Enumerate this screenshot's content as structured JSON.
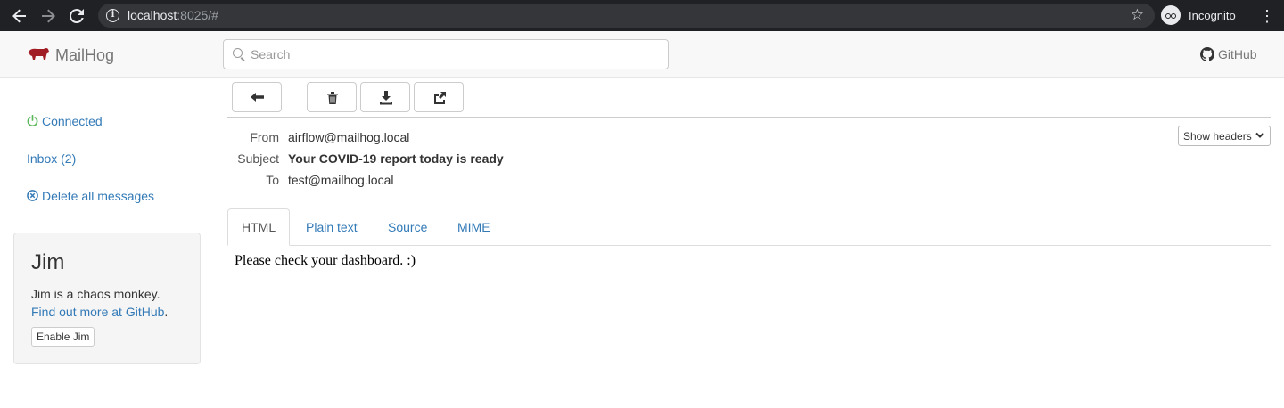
{
  "browser": {
    "url_host": "localhost",
    "url_rest": ":8025/#",
    "profile_label": "Incognito",
    "icons": [
      "back-arrow-icon",
      "forward-arrow-icon",
      "reload-icon",
      "info-icon",
      "star-icon",
      "incognito-icon",
      "kebab-menu-icon"
    ]
  },
  "app": {
    "brand": "MailHog",
    "brand_color": "#a01d26",
    "search_placeholder": "Search",
    "github_label": "GitHub"
  },
  "sidebar": {
    "connected_label": "Connected",
    "connected_color": "#5cb85c",
    "inbox_label": "Inbox (2)",
    "delete_all_label": "Delete all messages",
    "jim": {
      "title": "Jim",
      "description": "Jim is a chaos monkey.",
      "link_text": "Find out more at GitHub",
      "link_suffix": ".",
      "button_label": "Enable Jim"
    }
  },
  "toolbar": {
    "buttons": [
      "back-icon",
      "trash-icon",
      "download-icon",
      "release-icon"
    ]
  },
  "message": {
    "headers": [
      {
        "label": "From",
        "value": "airflow@mailhog.local"
      },
      {
        "label": "Subject",
        "value": "Your COVID-19 report today is ready"
      },
      {
        "label": "To",
        "value": "test@mailhog.local"
      }
    ],
    "show_headers_label": "Show headers",
    "tabs": [
      "HTML",
      "Plain text",
      "Source",
      "MIME"
    ],
    "active_tab": "HTML",
    "body": "Please check your dashboard. :)"
  },
  "colors": {
    "link": "#337ab7",
    "chrome_bg": "#202124"
  }
}
